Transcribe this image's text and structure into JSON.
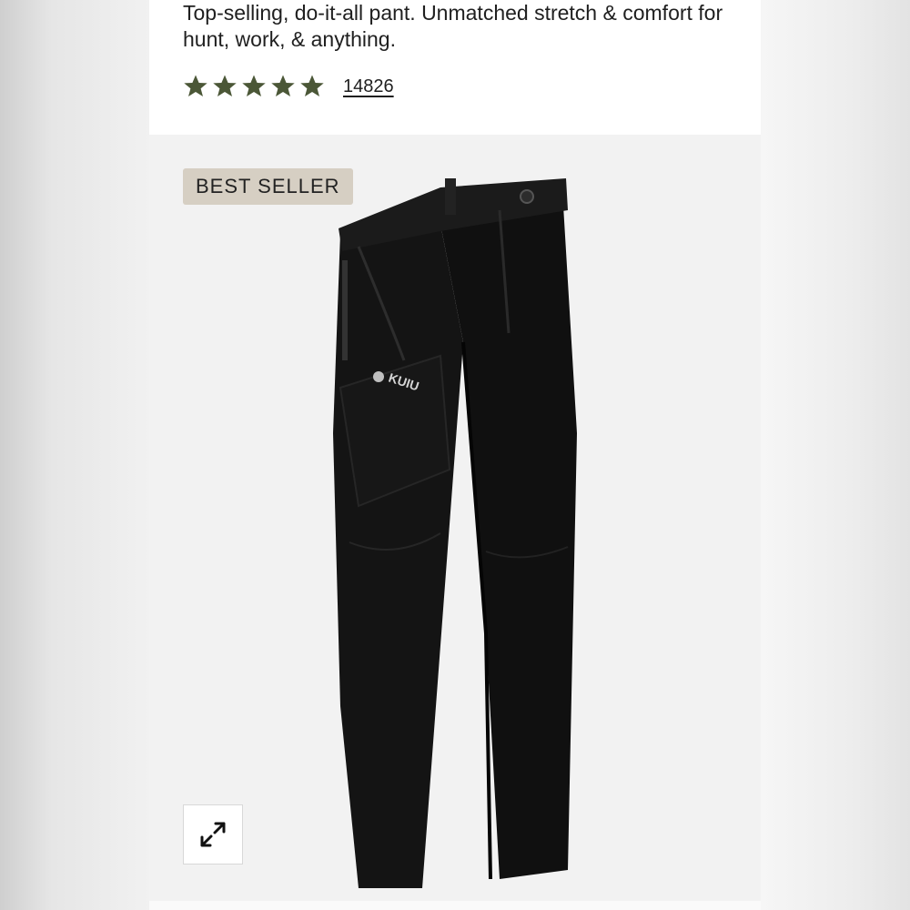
{
  "product": {
    "description": "Top-selling, do-it-all pant. Unmatched stretch & comfort for hunt, work, & anything.",
    "rating": 5,
    "review_count": "14826",
    "badge": "BEST SELLER",
    "image_alt": "Black pants product image",
    "logo_text": "KUIU"
  },
  "icons": {
    "star": "star-icon",
    "expand": "expand-icon"
  },
  "colors": {
    "star": "#4b5737",
    "badge_bg": "#d6cfc3",
    "image_bg": "#f2f2f2",
    "pants": "#141414"
  }
}
